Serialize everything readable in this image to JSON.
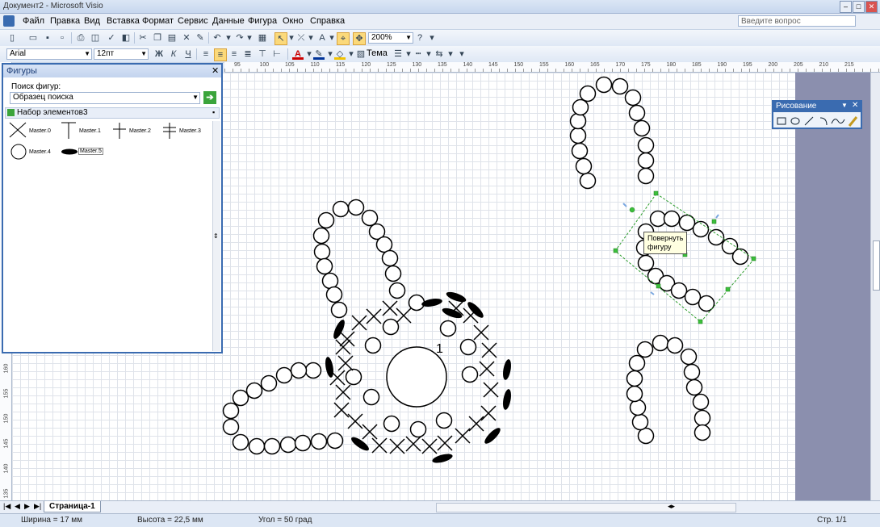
{
  "window": {
    "title": "Документ2 - Microsoft Visio",
    "help_placeholder": "Введите вопрос",
    "close_glyph": "✕"
  },
  "menu": [
    "Файл",
    "Правка",
    "Вид",
    "Вставка",
    "Формат",
    "Сервис",
    "Данные",
    "Фигура",
    "Окно",
    "Справка"
  ],
  "toolbar": {
    "zoom": "200%",
    "theme_label": "Тема"
  },
  "format_toolbar": {
    "font": "Arial",
    "size": "12пт",
    "bold": "Ж",
    "italic": "К",
    "underline": "Ч"
  },
  "ruler": {
    "h_ticks": [
      "95",
      "100",
      "105",
      "110",
      "115",
      "120",
      "125",
      "130",
      "135",
      "140",
      "145",
      "150",
      "155",
      "160",
      "165",
      "170",
      "175",
      "180",
      "185",
      "190",
      "195",
      "200",
      "205",
      "210",
      "215"
    ],
    "v_ticks": [
      "160",
      "155",
      "150",
      "145",
      "140",
      "135"
    ]
  },
  "shapes_panel": {
    "title": "Фигуры",
    "search_label": "Поиск фигур:",
    "search_placeholder": "Образец поиска",
    "stencil_title": "Набор элементов3",
    "masters": [
      "Master.0",
      "Master.1",
      "Master.2",
      "Master.3",
      "Master.4",
      "Master.5"
    ]
  },
  "drawing_toolbar": {
    "title": "Рисование"
  },
  "canvas": {
    "tooltip_line1": "Повернуть",
    "tooltip_line2": "фигуру",
    "label": "1"
  },
  "tabs": {
    "page": "Страница-1"
  },
  "status": {
    "width": "Ширина = 17 мм",
    "height": "Высота = 22,5 мм",
    "angle": "Угол = 50 град",
    "page": "Стр. 1/1"
  }
}
